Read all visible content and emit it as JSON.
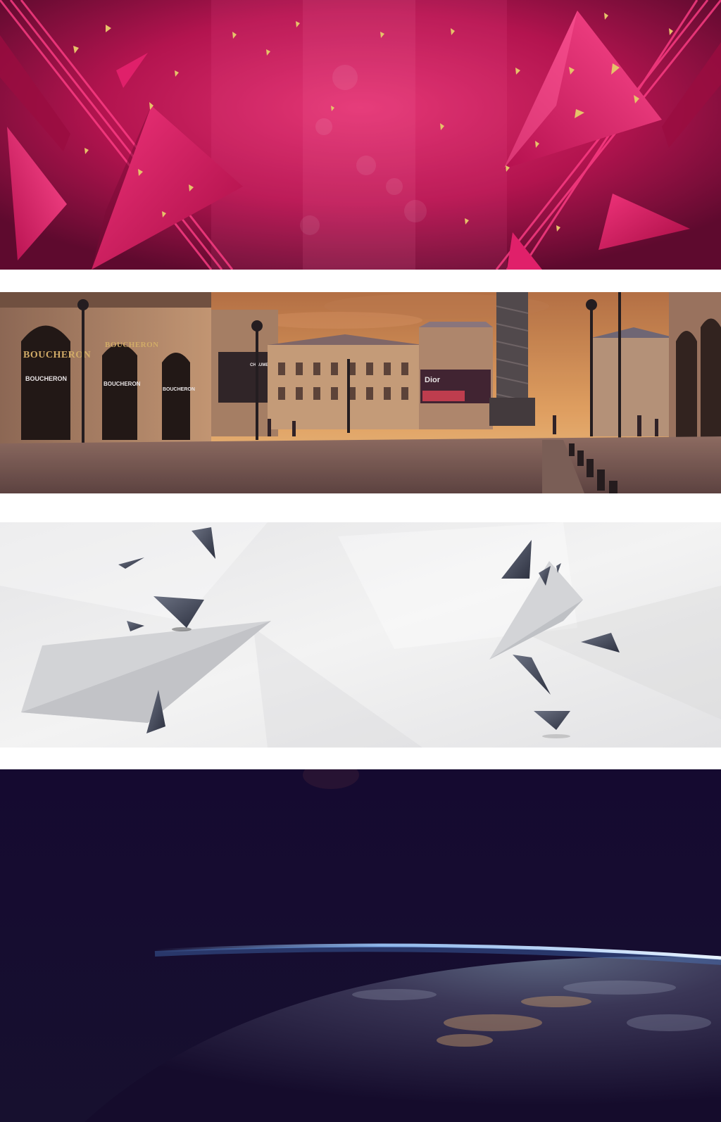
{
  "panels": [
    {
      "name": "red-geometric-banner"
    },
    {
      "name": "paris-square-banner"
    },
    {
      "name": "gray-paper-plane-banner"
    },
    {
      "name": "earth-horizon-banner"
    }
  ],
  "storefront_signs": [
    "BOUCHERON",
    "BOUCHERON",
    "BOUCHERON",
    "BOUCHERON",
    "BOUCHERON"
  ],
  "billboards": [
    "CHAUMET",
    "Dior"
  ],
  "colors": {
    "red_bg": "#c2185b",
    "red_dark": "#6a0b33",
    "gold": "#e6c36a",
    "sky": "#d89a55",
    "stone": "#b58f6a",
    "gray_bg": "#ececec",
    "shard": "#4a4f5e",
    "space": "#140b2e",
    "atmosphere": "#8fc4ff"
  }
}
